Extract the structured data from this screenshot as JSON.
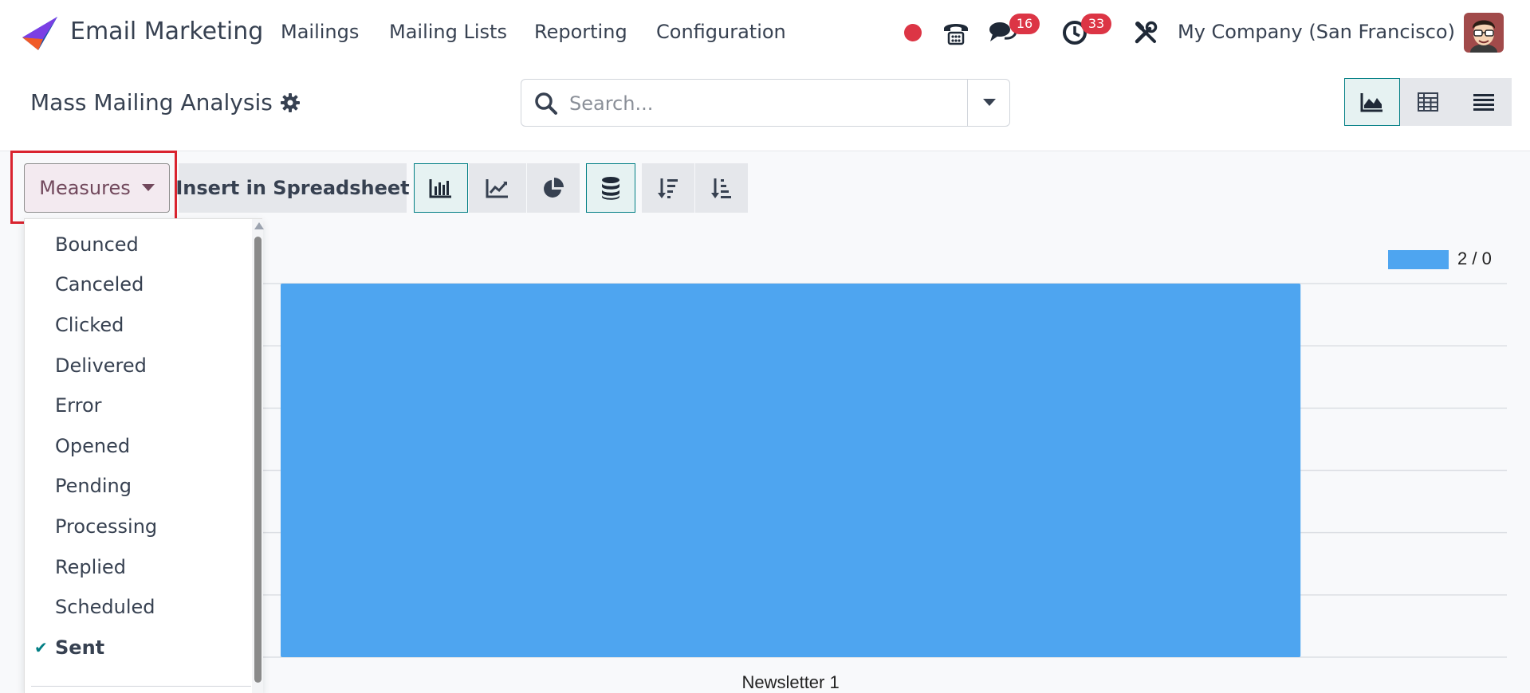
{
  "navbar": {
    "app_name": "Email Marketing",
    "menu": [
      "Mailings",
      "Mailing Lists",
      "Reporting",
      "Configuration"
    ],
    "messages_badge": "16",
    "activities_badge": "33",
    "company": "My Company (San Francisco)"
  },
  "control_panel": {
    "title": "Mass Mailing Analysis",
    "search_placeholder": "Search...",
    "views": [
      "graph",
      "pivot",
      "list"
    ],
    "active_view": "graph"
  },
  "toolbar": {
    "measures_label": "Measures",
    "insert_label": "Insert in Spreadsheet"
  },
  "measures_menu": {
    "items": [
      "Bounced",
      "Canceled",
      "Clicked",
      "Delivered",
      "Error",
      "Opened",
      "Pending",
      "Processing",
      "Replied",
      "Scheduled",
      "Sent"
    ],
    "selected": "Sent"
  },
  "chart_data": {
    "type": "bar",
    "categories": [
      "Newsletter 1"
    ],
    "series": [
      {
        "name": "2 / 0",
        "color": "#4ea5f0",
        "values": [
          2
        ]
      }
    ],
    "ylim": [
      0,
      2
    ],
    "grid": true,
    "legend": "top-right"
  },
  "colors": {
    "accent": "#017e84",
    "measures_text": "#71485c",
    "badge": "#dc3545",
    "record_dot": "#dc3545",
    "highlight": "#d9232f"
  }
}
